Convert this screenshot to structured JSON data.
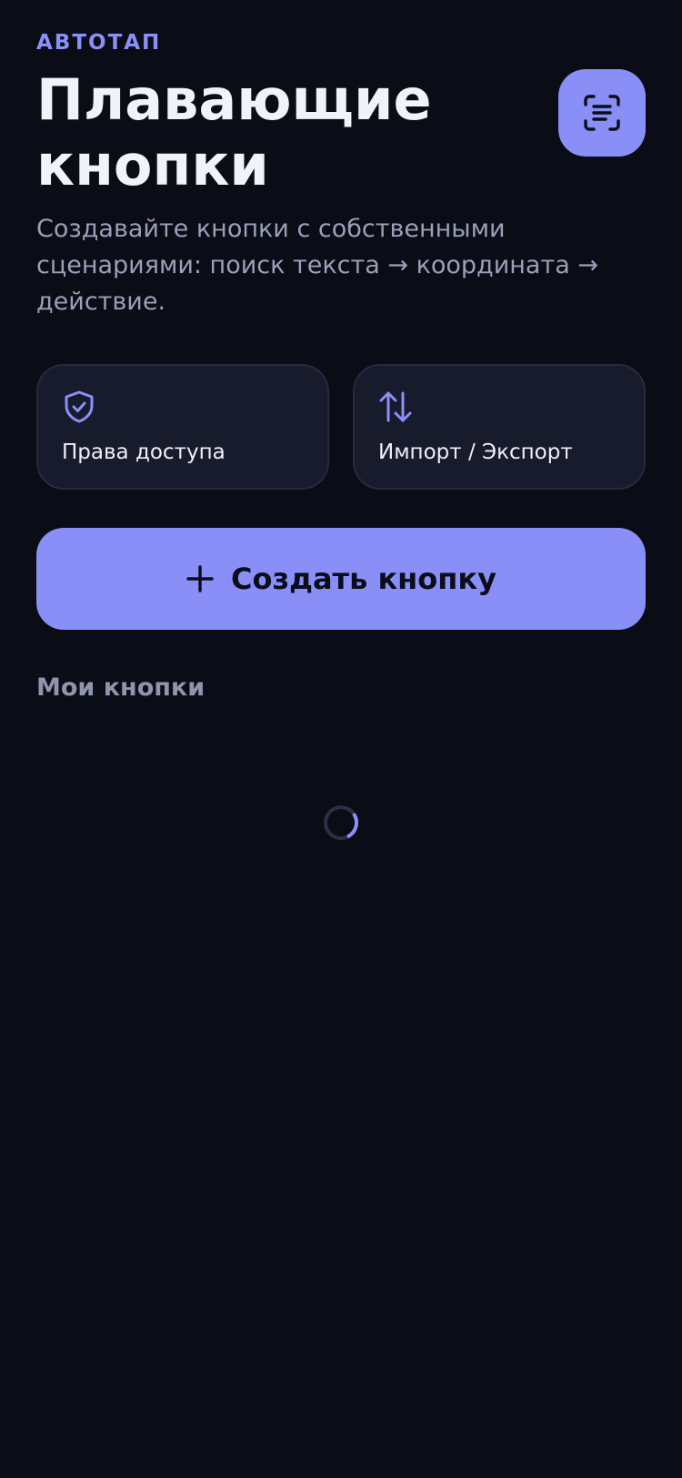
{
  "header": {
    "eyebrow": "АВТОТАП",
    "title": "Плавающие кнопки",
    "subtitle": "Создавайте кнопки с собственными сценариями: поиск текста → координата → действие."
  },
  "actions": {
    "permissions_label": "Права доступа",
    "import_export_label": "Импорт / Экспорт",
    "create_label": "Создать кнопку"
  },
  "section": {
    "my_buttons_title": "Мои кнопки"
  },
  "icons": {
    "scan": "scan-text-icon",
    "permissions": "shield-check-icon",
    "import_export": "arrows-up-down-icon",
    "create": "plus-icon",
    "loading": "loading-spinner-icon"
  },
  "colors": {
    "background": "#0a0c16",
    "accent": "#8a8ff8",
    "card": "#181b2b",
    "text_primary": "#f1f3fb",
    "text_muted": "#9aa0b8"
  }
}
